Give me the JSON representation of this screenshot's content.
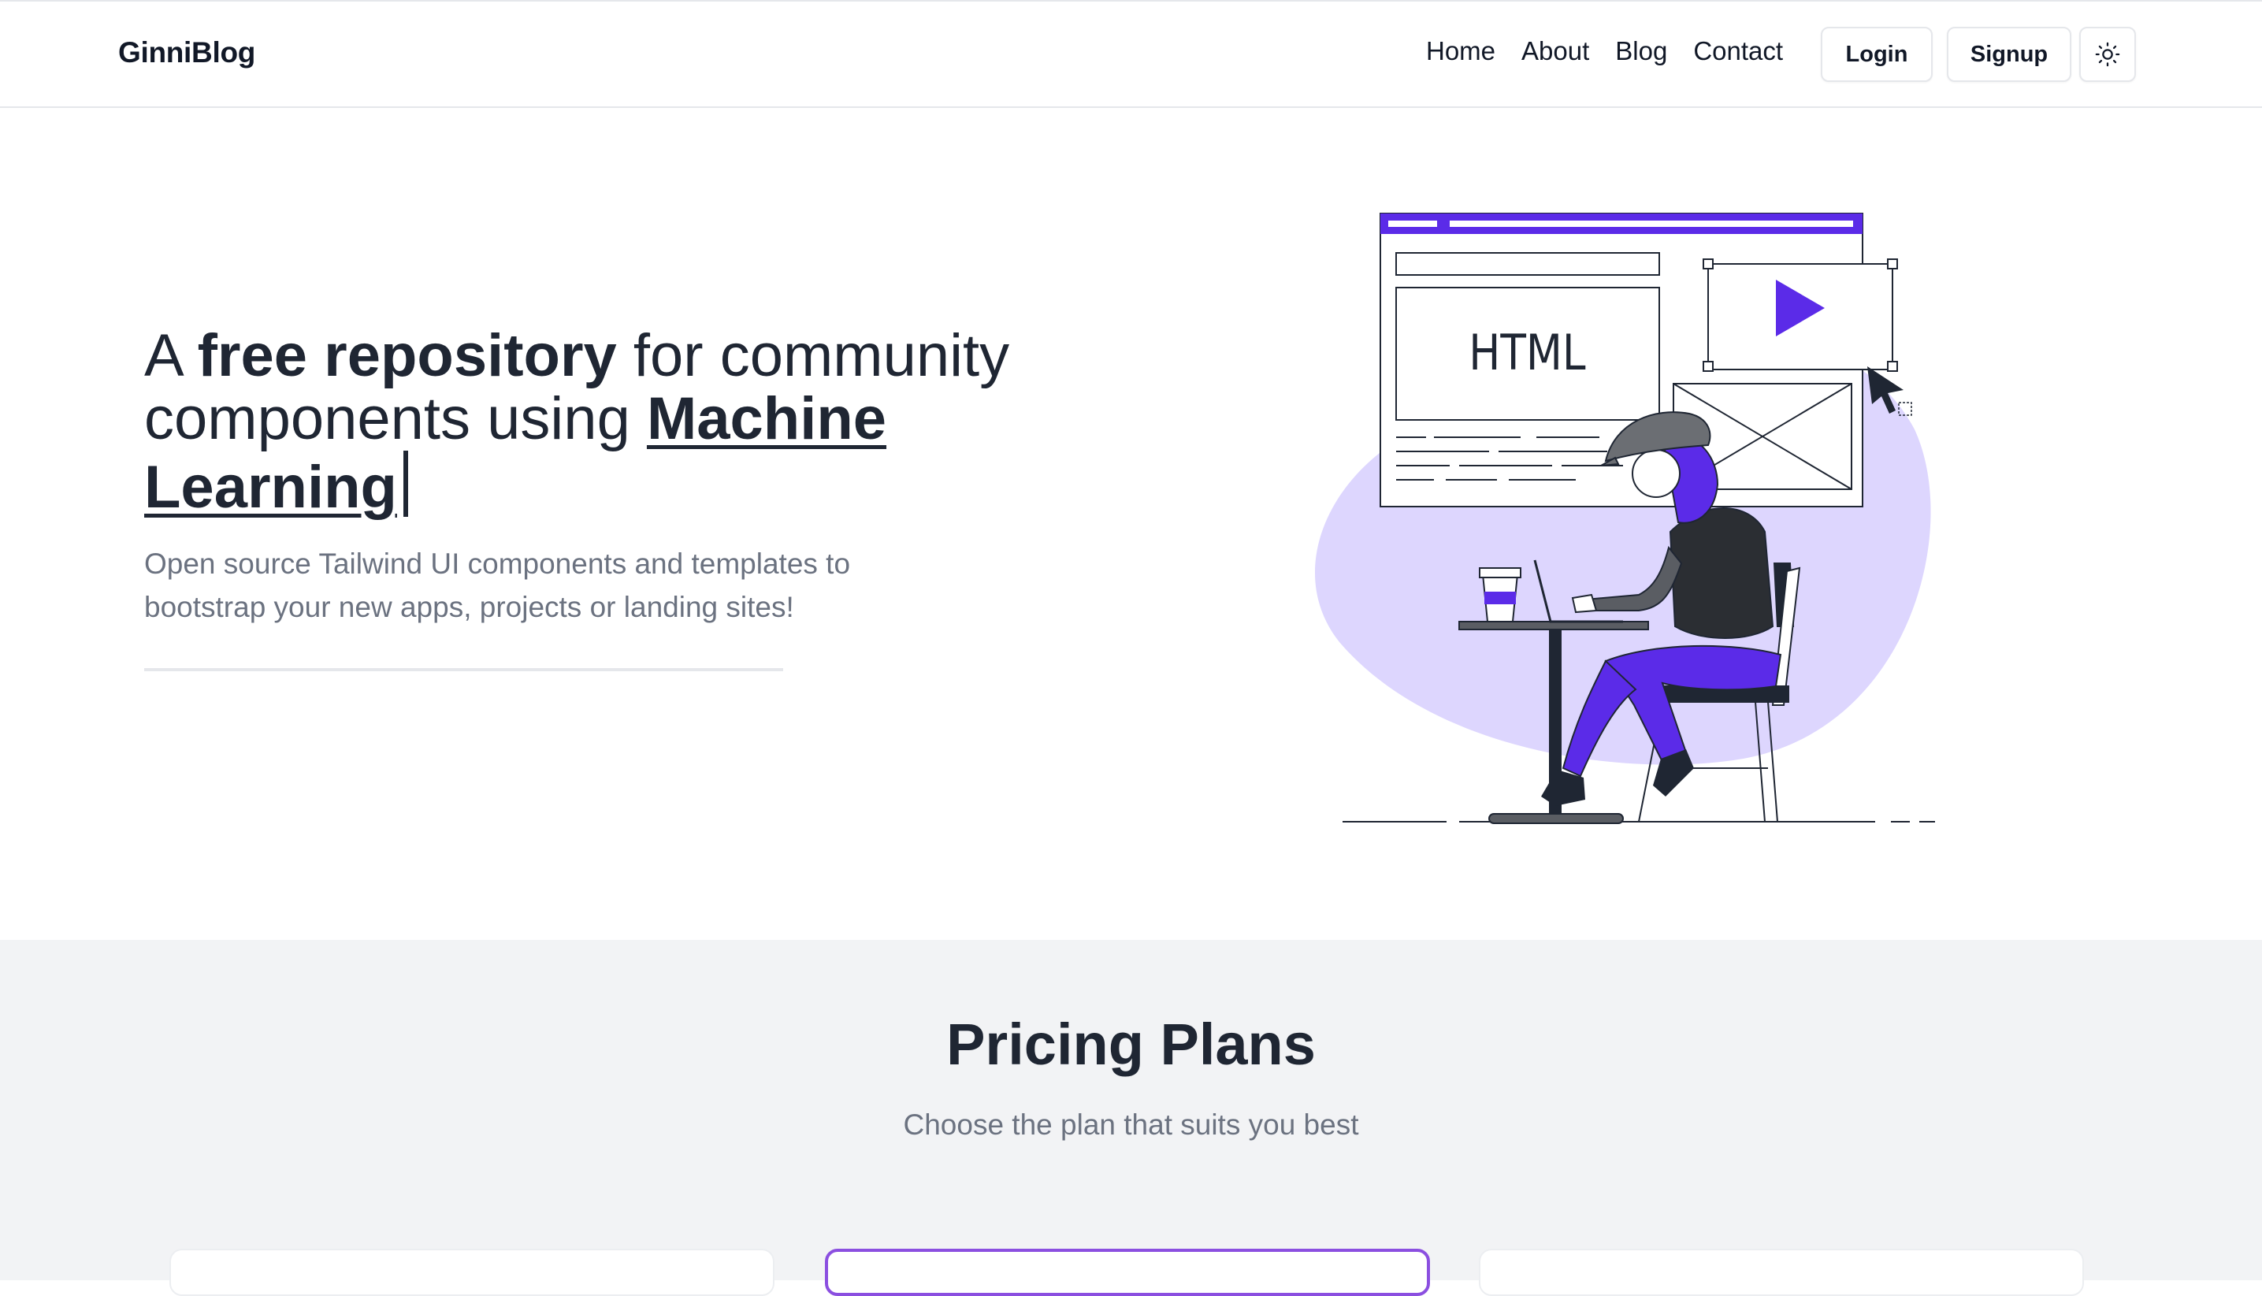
{
  "nav": {
    "brand": "GinniBlog",
    "links": [
      {
        "label": "Home"
      },
      {
        "label": "About"
      },
      {
        "label": "Blog"
      },
      {
        "label": "Contact"
      }
    ],
    "login_label": "Login",
    "signup_label": "Signup",
    "theme_icon": "sun-icon"
  },
  "hero": {
    "title_part1": "A ",
    "title_bold": "free repository",
    "title_part2": " for community components using ",
    "title_underlined": "Machine Learning",
    "subtitle": "Open source Tailwind UI components and templates to bootstrap your new apps, projects or landing sites!",
    "illustration_label": "HTML"
  },
  "pricing": {
    "title": "Pricing Plans",
    "subtitle": "Choose the plan that suits you best"
  },
  "colors": {
    "accent": "#5b2be8",
    "blob": "#ddd6fe",
    "highlight_border": "#8b4fe0",
    "section_bg": "#f2f3f5"
  }
}
